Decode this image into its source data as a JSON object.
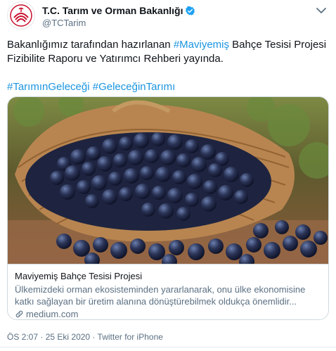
{
  "account": {
    "name": "T.C. Tarım ve Orman Bakanlığı",
    "handle": "@TCTarim"
  },
  "tweet": {
    "text_part1": "Bakanlığımız tarafından hazırlanan ",
    "hashtag1": "#Maviyemiş",
    "text_part2": " Bahçe Tesisi Projesi Fizibilite Raporu ve Yatırımcı Rehberi yayında.",
    "hashtag2": "#TarımınGeleceği",
    "hashtag3": "#GeleceğinTarımı"
  },
  "card": {
    "title": "Maviyemiş Bahçe Tesisi Projesi",
    "description": "Ülkemizdeki orman ekosisteminden yararlanarak, onu ülke ekonomisine katkı sağlayan bir üretim alanına dönüştürebilmek oldukça önemlidir...",
    "domain": "medium.com"
  },
  "meta": {
    "time": "ÖS 2:07",
    "separator1": " · ",
    "date": "25 Eki 2020",
    "separator2": " · ",
    "source": "Twitter for iPhone"
  },
  "colors": {
    "link": "#1b95e0",
    "secondary_text": "#5b7083",
    "logo_red": "#c8102e"
  },
  "icons": [
    "ministry-logo-icon",
    "verified-badge-icon",
    "more-options-icon",
    "link-icon"
  ]
}
